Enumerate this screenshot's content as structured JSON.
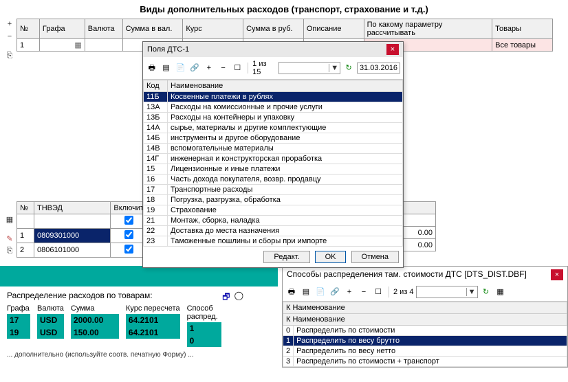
{
  "title": "Виды дополнительных расходов (транспорт, страхование и т.д.)",
  "main_grid": {
    "headers": [
      "№",
      "Графа",
      "Валюта",
      "Сумма в вал.",
      "Курс",
      "Сумма в руб.",
      "Описание",
      "По какому параметру рассчитывать",
      "Товары"
    ],
    "rows": [
      {
        "num": "1",
        "grafa": "",
        "valuta": "",
        "summa_val": "",
        "kurs": "",
        "summa_rub": "",
        "opis": "",
        "param": "",
        "tovary": "Все товары"
      }
    ]
  },
  "dialog": {
    "title": "Поля ДТС-1",
    "counter": "1 из 15",
    "date": "31.03.2016",
    "headers": [
      "Код",
      "Наименование"
    ],
    "items": [
      {
        "code": "11Б",
        "name": "Косвенные платежи в рублях",
        "sel": true
      },
      {
        "code": "13А",
        "name": "Расходы на комиссионные и прочие услуги"
      },
      {
        "code": "13Б",
        "name": "Расходы на контейнеры и упаковку"
      },
      {
        "code": "14А",
        "name": "сырье, материалы и другие комплектующие"
      },
      {
        "code": "14Б",
        "name": "инструменты и другое оборудование"
      },
      {
        "code": "14В",
        "name": "вспомогательные материалы"
      },
      {
        "code": "14Г",
        "name": "инженерная и конструкторская проработка"
      },
      {
        "code": "15",
        "name": "Лицензионные и иные платежи"
      },
      {
        "code": "16",
        "name": "Часть дохода покупателя, возвр. продавцу"
      },
      {
        "code": "17",
        "name": "Транспортные расходы"
      },
      {
        "code": "18",
        "name": "Погрузка, разгрузка, обработка"
      },
      {
        "code": "19",
        "name": "Страхование"
      },
      {
        "code": "21",
        "name": "Монтаж, сборка, наладка"
      },
      {
        "code": "22",
        "name": "Доставка до места назначения"
      },
      {
        "code": "23",
        "name": "Таможенные пошлины и сборы при импорте"
      }
    ],
    "buttons": {
      "edit": "Редакт.",
      "ok": "OK",
      "cancel": "Отмена"
    }
  },
  "tnved_grid": {
    "headers": [
      "№",
      "ТНВЭД",
      "Включит"
    ],
    "rows": [
      {
        "num": "1",
        "tnved": "0809301000",
        "incl": true,
        "val": "0.00",
        "sel": true
      },
      {
        "num": "2",
        "tnved": "0806101000",
        "incl": true,
        "val": "0.00"
      }
    ]
  },
  "dist_panel": {
    "title": "Распределение расходов по товарам:",
    "columns": {
      "grafa": {
        "label": "Графа",
        "vals": [
          "17",
          "19"
        ]
      },
      "valuta": {
        "label": "Валюта",
        "vals": [
          "USD",
          "USD"
        ]
      },
      "summa": {
        "label": "Сумма",
        "vals": [
          "2000.00",
          "150.00"
        ]
      },
      "kurs": {
        "label": "Курс пересчета",
        "vals": [
          "64.2101",
          "64.2101"
        ]
      },
      "sposob": {
        "label": "Способ распред.",
        "vals": [
          "1",
          "0"
        ]
      }
    },
    "footnote": "... дополнительно (используйте соотв. печатную Форму) ..."
  },
  "dist_dialog": {
    "title": "Способы распределения там. стоимости ДТС  [DTS_DIST.DBF]",
    "counter": "2 из 4",
    "header1": "К Наименование",
    "header2": "К Наименование",
    "items": [
      {
        "k": "0",
        "name": "Распределить по стоимости"
      },
      {
        "k": "1",
        "name": "Распределить по весу брутто",
        "sel": true
      },
      {
        "k": "2",
        "name": "Распределить по весу нетто"
      },
      {
        "k": "3",
        "name": "Распределить по стоимости + транспорт"
      }
    ]
  }
}
